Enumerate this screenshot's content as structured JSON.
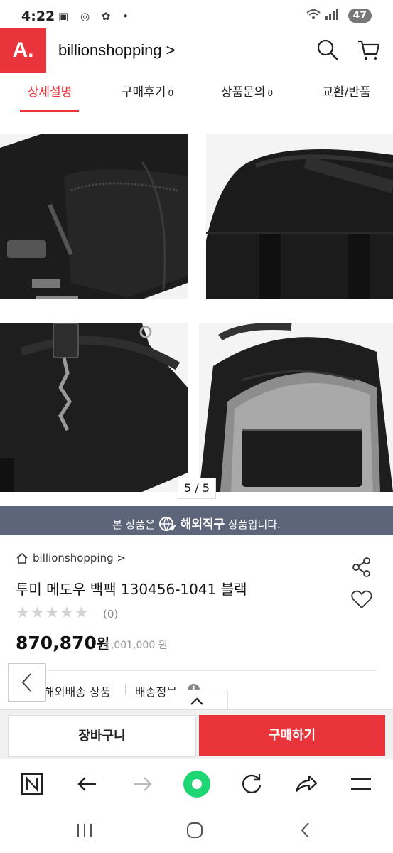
{
  "status_bar": {
    "time": "4:22",
    "battery": "47"
  },
  "header": {
    "logo": "A.",
    "shop_name": "billionshopping >"
  },
  "tabs": [
    {
      "label": "상세설명",
      "count": ""
    },
    {
      "label": "구매후기",
      "count": "0"
    },
    {
      "label": "상품문의",
      "count": "0"
    },
    {
      "label": "교환/반품",
      "count": ""
    }
  ],
  "gallery": {
    "pager": "5 / 5"
  },
  "banner": {
    "prefix": "본 상품은",
    "highlight": "해외직구",
    "suffix": "상품입니다."
  },
  "product": {
    "breadcrumb": "billionshopping >",
    "title": "투미 메도우 백팩 130456-1041 블랙",
    "stars": "★★★★★",
    "review_count": "(0)",
    "price": "870,870",
    "price_unit": "원",
    "original_price": "1,001,000 원",
    "shipping_type": "해외배송 상품",
    "shipping_info": "배송정보"
  },
  "actions": {
    "cart": "장바구니",
    "buy": "구매하기"
  },
  "colors": {
    "brand_red": "#e8343a",
    "banner_bg": "#5c6579",
    "home_green": "#1fd675"
  }
}
